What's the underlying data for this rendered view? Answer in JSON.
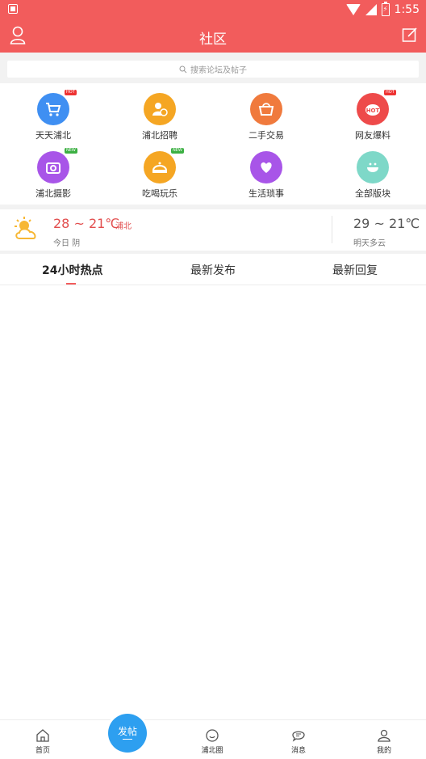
{
  "status": {
    "time": "1:55",
    "battery": "⚡"
  },
  "header": {
    "title": "社区"
  },
  "search": {
    "placeholder": "搜索论坛及帖子"
  },
  "modules": [
    {
      "label": "天天浦北",
      "icon": "cart-icon",
      "color": "#3f8ff2",
      "badge": "HOT",
      "badge_color": "#e33"
    },
    {
      "label": "浦北招聘",
      "icon": "recruit-icon",
      "color": "#f5a623",
      "badge": "",
      "badge_color": ""
    },
    {
      "label": "二手交易",
      "icon": "basket-icon",
      "color": "#f07a3d",
      "badge": "",
      "badge_color": ""
    },
    {
      "label": "网友爆料",
      "icon": "hot-icon",
      "color": "#ee4a4a",
      "badge": "HOT",
      "badge_color": "#e33"
    },
    {
      "label": "浦北摄影",
      "icon": "camera-icon",
      "color": "#a855e8",
      "badge": "NEW",
      "badge_color": "#3cb043"
    },
    {
      "label": "吃喝玩乐",
      "icon": "food-icon",
      "color": "#f5a623",
      "badge": "NEW",
      "badge_color": "#3cb043"
    },
    {
      "label": "生活琐事",
      "icon": "heart-icon",
      "color": "#a855e8",
      "badge": "",
      "badge_color": ""
    },
    {
      "label": "全部版块",
      "icon": "smile-icon",
      "color": "#7ed8c8",
      "badge": "",
      "badge_color": ""
    }
  ],
  "weather": {
    "today_temp": "28 ~ 21℃",
    "city": "浦北",
    "today_desc": "今日 阴",
    "tomorrow_temp": "29 ~ 21℃",
    "tomorrow_desc": "明天多云"
  },
  "tabs": [
    {
      "label": "24小时热点",
      "active": true
    },
    {
      "label": "最新发布",
      "active": false
    },
    {
      "label": "最新回复",
      "active": false
    }
  ],
  "bottom_nav": {
    "home": "首页",
    "post_line1": "发帖",
    "circle": "浦北圈",
    "messages": "消息",
    "mine": "我的"
  },
  "colors": {
    "brand": "#f25c5c",
    "post_button": "#2d9ff0"
  }
}
